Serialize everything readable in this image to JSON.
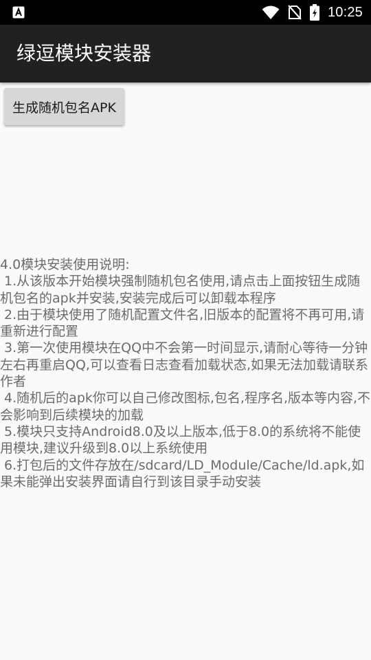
{
  "status_bar": {
    "time": "10:25",
    "icons": [
      "app-notification-icon",
      "wifi-icon",
      "no-sim-icon",
      "battery-charging-icon"
    ]
  },
  "app_bar": {
    "title": "绿逗模块安装器"
  },
  "actions": {
    "generate_label": "生成随机包名APK"
  },
  "instructions": {
    "heading": "4.0模块安装使用说明:",
    "items": [
      " 1.从该版本开始模块强制随机包名使用,请点击上面按钮生成随机包名的apk并安装,安装完成后可以卸载本程序",
      " 2.由于模块使用了随机配置文件名,旧版本的配置将不再可用,请重新进行配置",
      " 3.第一次使用模块在QQ中不会第一时间显示,请耐心等待一分钟左右再重启QQ,可以查看日志查看加载状态,如果无法加载请联系作者",
      " 4.随机后的apk你可以自己修改图标,包名,程序名,版本等内容,不会影响到后续模块的加载",
      " 5.模块只支持Android8.0及以上版本,低于8.0的系统将不能使用模块,建议升级到8.0以上系统使用",
      " 6.打包后的文件存放在/sdcard/LD_Module/Cache/ld.apk,如果未能弹出安装界面请自行到该目录手动安装"
    ]
  },
  "colors": {
    "status_bar": "#000000",
    "app_bar": "#212121",
    "background": "#fafafa",
    "button": "#d6d7d7",
    "body_text": "#6b6b6b"
  }
}
